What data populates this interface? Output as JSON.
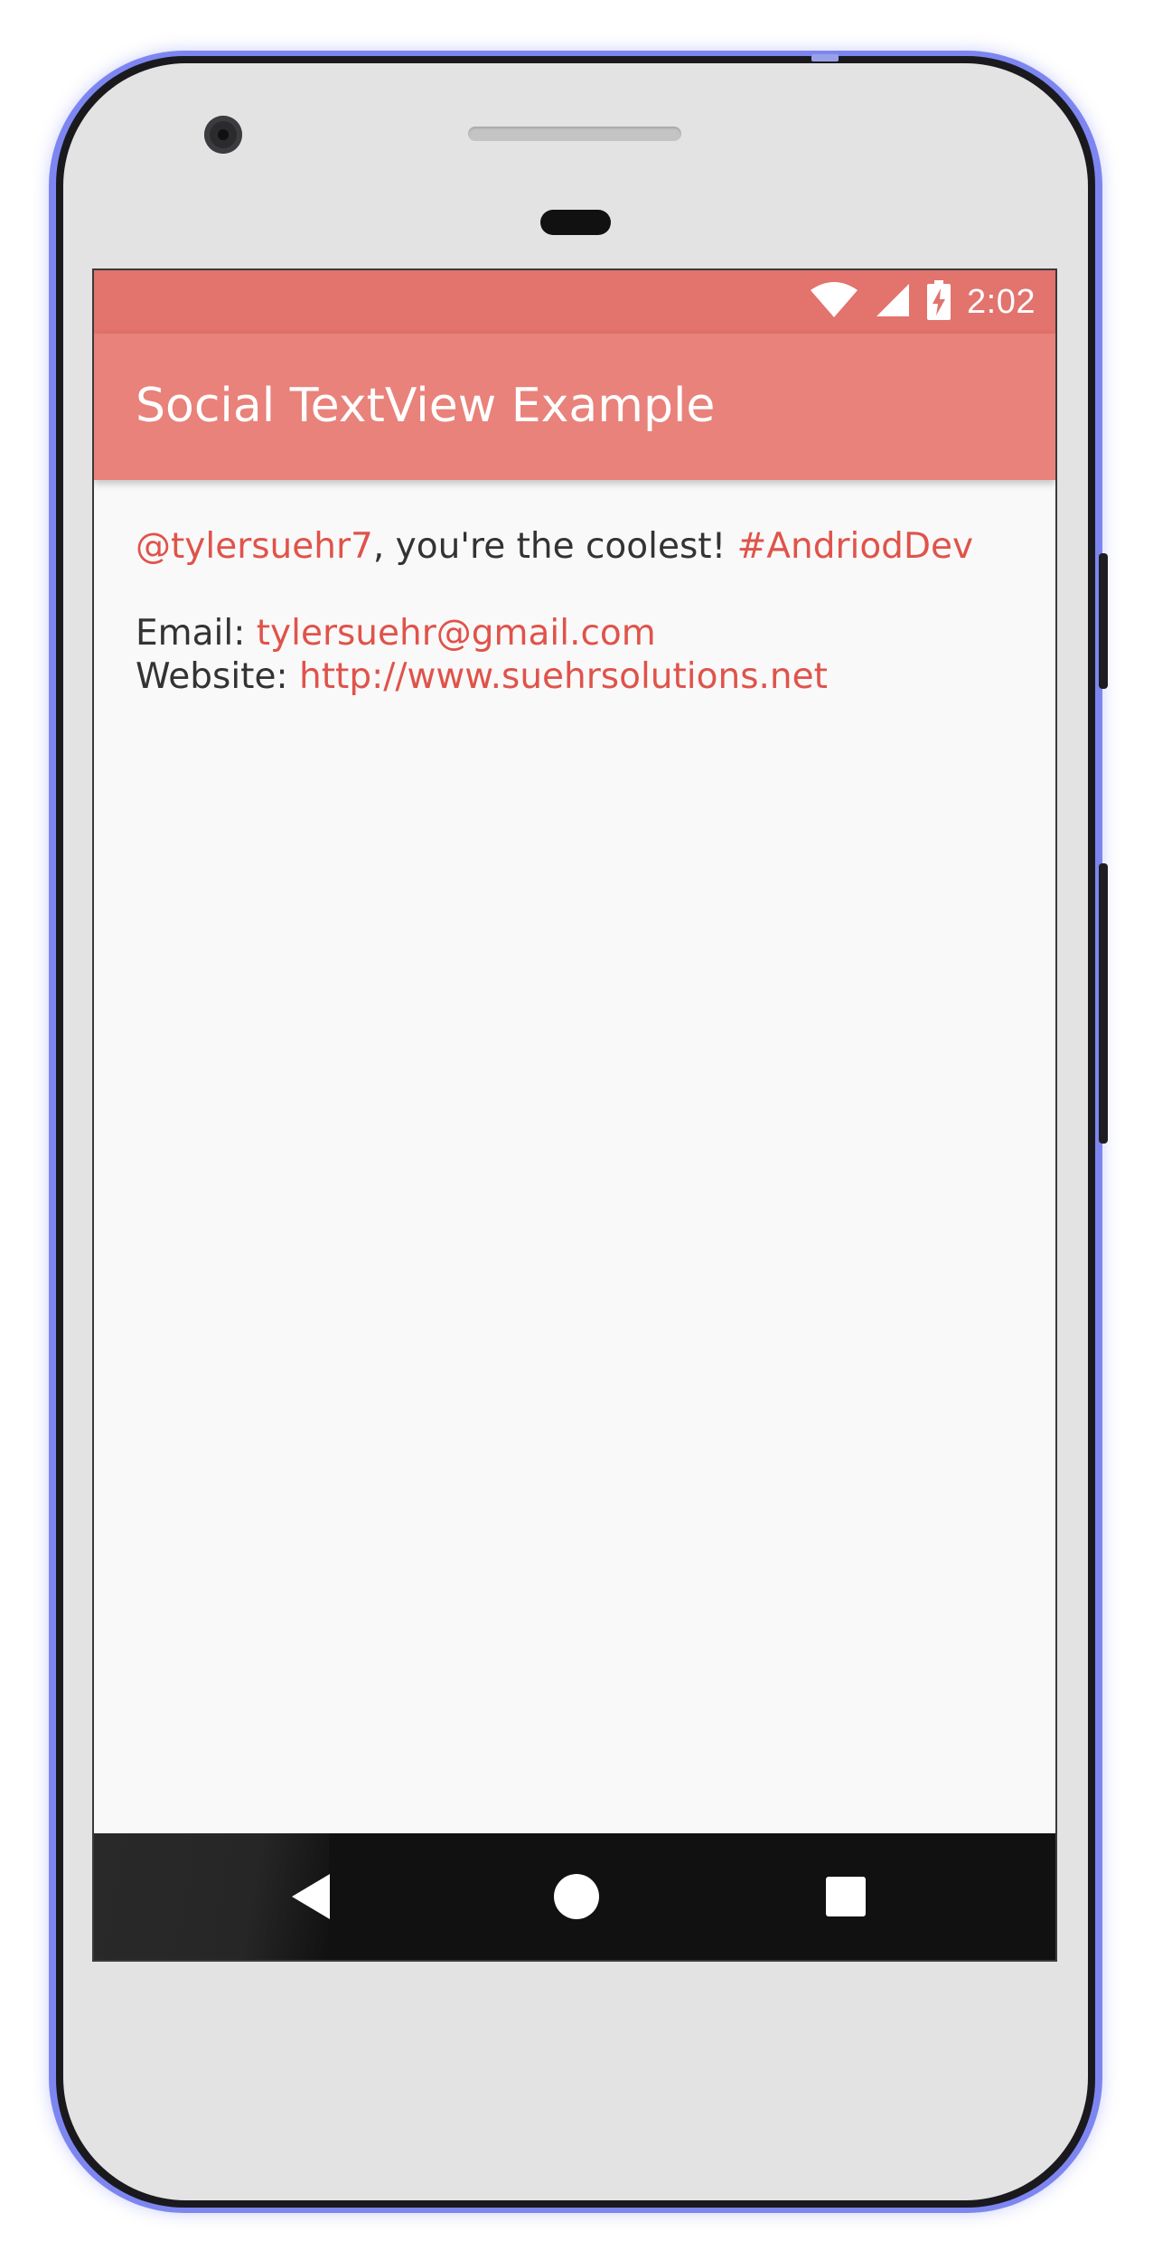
{
  "status_bar": {
    "time": "2:02",
    "icons": [
      "wifi-icon",
      "cell-signal-icon",
      "battery-charging-icon"
    ]
  },
  "app_bar": {
    "title": "Social TextView Example"
  },
  "content": {
    "mention": "@tylersuehr7",
    "greeting_text": ", you're the coolest! ",
    "hashtag": "#AndriodDev",
    "email_label": "Email: ",
    "email_link": "tylersuehr@gmail.com",
    "website_label": "Website: ",
    "website_link": "http://www.suehrsolutions.net"
  },
  "nav_bar": {
    "buttons": [
      "back-icon",
      "home-icon",
      "recents-icon"
    ]
  },
  "colors": {
    "status_bar": "#e2736d",
    "app_bar": "#e8827b",
    "link": "#e0534a",
    "body_text": "#333333",
    "screen_background": "#f9f9f9",
    "nav_bar": "#111111",
    "device_frame_accent": "#7d86f0"
  }
}
